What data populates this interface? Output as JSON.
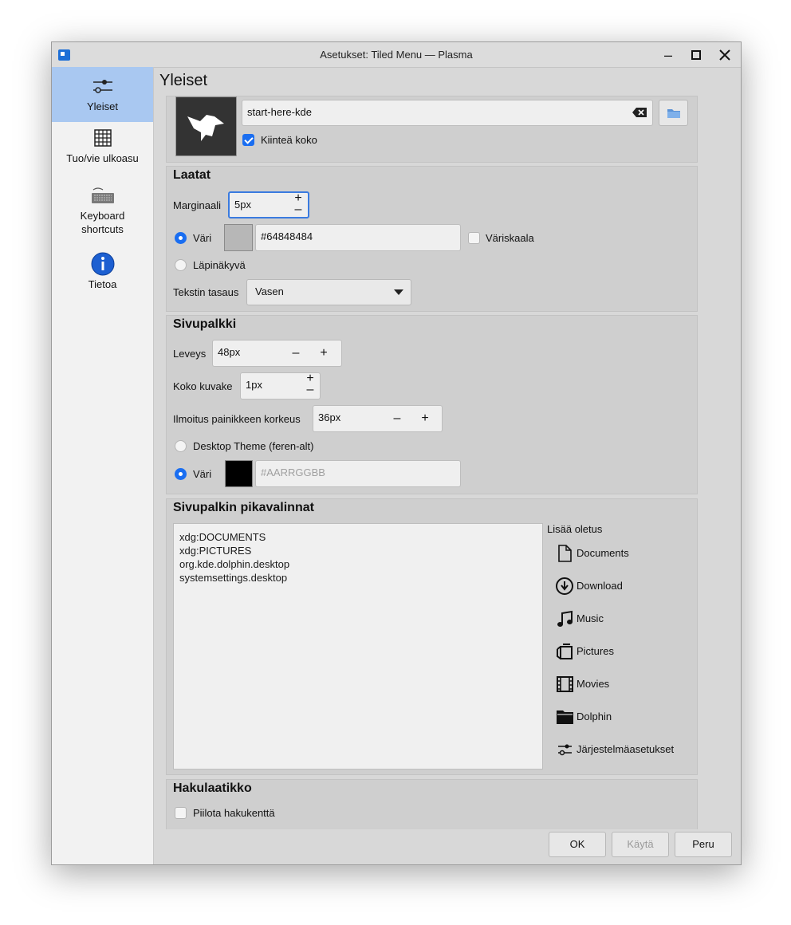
{
  "window": {
    "title": "Asetukset: Tiled Menu — Plasma"
  },
  "sidebar": {
    "items": [
      {
        "label": "Yleiset"
      },
      {
        "label": "Tuo/vie ulkoasu"
      },
      {
        "label_line1": "Keyboard",
        "label_line2": "shortcuts"
      },
      {
        "label": "Tietoa"
      }
    ]
  },
  "page": {
    "title": "Yleiset"
  },
  "icon_section": {
    "icon_name_value": "start-here-kde",
    "fixed_size_label": "Kiinteä koko",
    "fixed_size_checked": true
  },
  "tiles": {
    "title": "Laatat",
    "margin_label": "Marginaali",
    "margin_value": "5px",
    "color_label": "Väri",
    "color_value": "#64848484",
    "color_swatch": "#b7b7b7",
    "gradient_label": "Väriskaala",
    "transparent_label": "Läpinäkyvä",
    "text_align_label": "Tekstin tasaus",
    "text_align_value": "Vasen"
  },
  "sidebar_panel": {
    "title": "Sivupalkki",
    "width_label": "Leveys",
    "width_value": "48px",
    "icon_size_label": "Koko kuvake",
    "icon_size_value": "1px",
    "button_height_label": "Ilmoitus painikkeen korkeus",
    "button_height_value": "36px",
    "theme_label": "Desktop Theme (feren-alt)",
    "color_label": "Väri",
    "color_placeholder": "#AARRGGBB",
    "color_swatch": "#000000"
  },
  "shortcuts": {
    "title": "Sivupalkin pikavalinnat",
    "entries": [
      "xdg:DOCUMENTS",
      "xdg:PICTURES",
      "org.kde.dolphin.desktop",
      "systemsettings.desktop"
    ],
    "add_default_label": "Lisää oletus",
    "defaults": [
      {
        "label": "Documents",
        "icon": "document-icon"
      },
      {
        "label": "Download",
        "icon": "download-icon"
      },
      {
        "label": "Music",
        "icon": "music-icon"
      },
      {
        "label": "Pictures",
        "icon": "pictures-icon"
      },
      {
        "label": "Movies",
        "icon": "movies-icon"
      },
      {
        "label": "Dolphin",
        "icon": "folder-icon"
      },
      {
        "label": "Järjestelmäasetukset",
        "icon": "settings-icon"
      }
    ]
  },
  "search": {
    "title": "Hakulaatikko",
    "hide_label": "Piilota hakukenttä"
  },
  "buttons": {
    "ok": "OK",
    "apply": "Käytä",
    "cancel": "Peru"
  }
}
